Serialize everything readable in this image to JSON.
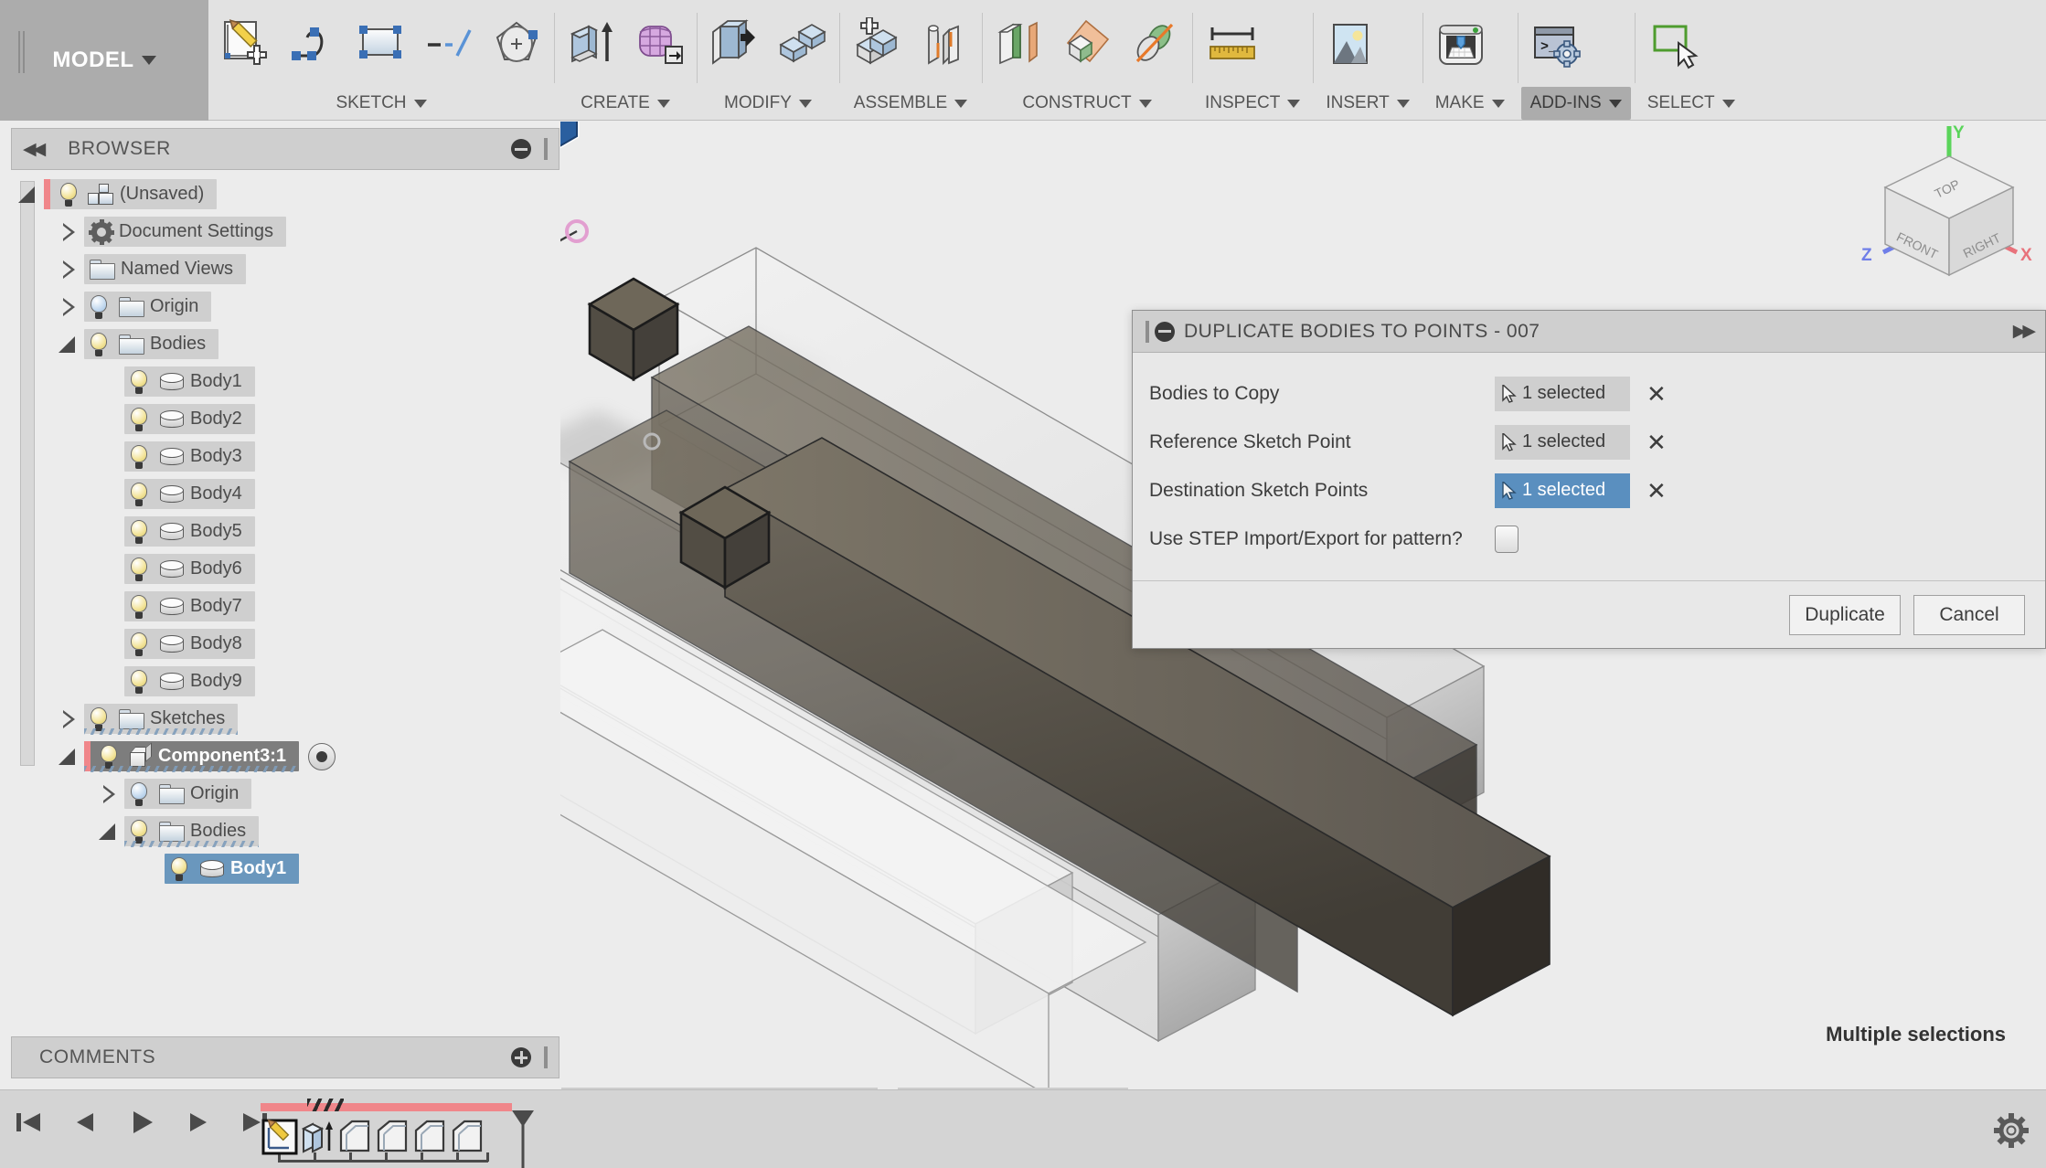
{
  "app": {
    "workspace_tab": "MODEL"
  },
  "ribbon": {
    "groups": [
      {
        "label": "SKETCH",
        "active": false,
        "icons": [
          "create-sketch-icon",
          "spline-icon",
          "rectangle-icon",
          "sketch-dimension-icon",
          "polygon-icon"
        ]
      },
      {
        "label": "CREATE",
        "active": false,
        "icons": [
          "extrude-icon",
          "mesh-create-icon"
        ]
      },
      {
        "label": "MODIFY",
        "active": false,
        "icons": [
          "press-pull-icon",
          "combine-icon"
        ]
      },
      {
        "label": "ASSEMBLE",
        "active": false,
        "icons": [
          "new-component-icon",
          "joint-icon"
        ]
      },
      {
        "label": "CONSTRUCT",
        "active": false,
        "icons": [
          "offset-plane-icon",
          "plane-at-angle-icon",
          "axis-through-cylinder-icon"
        ]
      },
      {
        "label": "INSPECT",
        "active": false,
        "icons": [
          "measure-icon"
        ]
      },
      {
        "label": "INSERT",
        "active": false,
        "icons": [
          "insert-image-icon"
        ]
      },
      {
        "label": "MAKE",
        "active": false,
        "icons": [
          "3d-print-icon"
        ]
      },
      {
        "label": "ADD-INS",
        "active": true,
        "icons": [
          "scripts-addins-icon"
        ]
      },
      {
        "label": "SELECT",
        "active": false,
        "icons": [
          "select-window-icon"
        ]
      }
    ]
  },
  "browser": {
    "title": "BROWSER",
    "collapse_icon": "double-left-arrow-icon",
    "minimize_icon": "minimize-icon",
    "tree": [
      {
        "label": "(Unsaved)",
        "indent": 0,
        "expander": "down",
        "bulb": "on",
        "icon": "assembly-icon",
        "state": "header",
        "redbar": true,
        "sketchline": false
      },
      {
        "label": "Document Settings",
        "indent": 1,
        "expander": "right",
        "bulb": "none",
        "icon": "gear-icon",
        "state": "normal",
        "redbar": false,
        "sketchline": false
      },
      {
        "label": "Named Views",
        "indent": 1,
        "expander": "right",
        "bulb": "none",
        "icon": "folder-icon",
        "state": "normal",
        "redbar": false,
        "sketchline": false
      },
      {
        "label": "Origin",
        "indent": 1,
        "expander": "right",
        "bulb": "off",
        "icon": "folder-icon",
        "state": "normal",
        "redbar": false,
        "sketchline": false
      },
      {
        "label": "Bodies",
        "indent": 1,
        "expander": "down",
        "bulb": "on",
        "icon": "folder-icon",
        "state": "normal",
        "redbar": false,
        "sketchline": false
      },
      {
        "label": "Body1",
        "indent": 2,
        "expander": "none",
        "bulb": "on",
        "icon": "body-icon",
        "state": "normal",
        "redbar": false,
        "sketchline": false
      },
      {
        "label": "Body2",
        "indent": 2,
        "expander": "none",
        "bulb": "on",
        "icon": "body-icon",
        "state": "normal",
        "redbar": false,
        "sketchline": false
      },
      {
        "label": "Body3",
        "indent": 2,
        "expander": "none",
        "bulb": "on",
        "icon": "body-icon",
        "state": "normal",
        "redbar": false,
        "sketchline": false
      },
      {
        "label": "Body4",
        "indent": 2,
        "expander": "none",
        "bulb": "on",
        "icon": "body-icon",
        "state": "normal",
        "redbar": false,
        "sketchline": false
      },
      {
        "label": "Body5",
        "indent": 2,
        "expander": "none",
        "bulb": "on",
        "icon": "body-icon",
        "state": "normal",
        "redbar": false,
        "sketchline": false
      },
      {
        "label": "Body6",
        "indent": 2,
        "expander": "none",
        "bulb": "on",
        "icon": "body-icon",
        "state": "normal",
        "redbar": false,
        "sketchline": false
      },
      {
        "label": "Body7",
        "indent": 2,
        "expander": "none",
        "bulb": "on",
        "icon": "body-icon",
        "state": "normal",
        "redbar": false,
        "sketchline": false
      },
      {
        "label": "Body8",
        "indent": 2,
        "expander": "none",
        "bulb": "on",
        "icon": "body-icon",
        "state": "normal",
        "redbar": false,
        "sketchline": false
      },
      {
        "label": "Body9",
        "indent": 2,
        "expander": "none",
        "bulb": "on",
        "icon": "body-icon",
        "state": "normal",
        "redbar": false,
        "sketchline": false
      },
      {
        "label": "Sketches",
        "indent": 1,
        "expander": "right",
        "bulb": "on",
        "icon": "folder-icon",
        "state": "normal",
        "redbar": false,
        "sketchline": true
      },
      {
        "label": "Component3:1",
        "indent": 1,
        "expander": "down",
        "bulb": "on",
        "icon": "component-icon",
        "state": "active",
        "redbar": true,
        "sketchline": true,
        "radio": true
      },
      {
        "label": "Origin",
        "indent": 2,
        "expander": "right",
        "bulb": "off",
        "icon": "folder-icon",
        "state": "normal",
        "redbar": false,
        "sketchline": false
      },
      {
        "label": "Bodies",
        "indent": 2,
        "expander": "down",
        "bulb": "on",
        "icon": "folder-icon",
        "state": "normal",
        "redbar": false,
        "sketchline": true
      },
      {
        "label": "Body1",
        "indent": 3,
        "expander": "none",
        "bulb": "on",
        "icon": "body-icon",
        "state": "selected",
        "redbar": false,
        "sketchline": false
      }
    ]
  },
  "comments": {
    "title": "COMMENTS",
    "add_icon": "plus-circle-icon"
  },
  "dialog": {
    "title": "DUPLICATE BODIES TO POINTS - 007",
    "collapse_icon": "minimize-icon",
    "expand_icon": "double-right-arrow-icon",
    "rows": [
      {
        "label": "Bodies to Copy",
        "type": "selection",
        "value": "1 selected",
        "active": false,
        "clear_icon": "x-icon"
      },
      {
        "label": "Reference Sketch Point",
        "type": "selection",
        "value": "1 selected",
        "active": false,
        "clear_icon": "x-icon"
      },
      {
        "label": "Destination Sketch Points",
        "type": "selection",
        "value": "1 selected",
        "active": true,
        "clear_icon": "x-icon"
      },
      {
        "label": "Use STEP Import/Export for pattern?",
        "type": "checkbox",
        "checked": false
      }
    ],
    "ok_label": "Duplicate",
    "cancel_label": "Cancel"
  },
  "viewport": {
    "status_text": "Multiple selections",
    "viewcube": {
      "top": "TOP",
      "front": "FRONT",
      "right": "RIGHT",
      "axis_x": "X",
      "axis_y": "Y",
      "axis_z": "Z",
      "color_x": "#e8727b",
      "color_y": "#5ad45a",
      "color_z": "#6f7ee8"
    },
    "highlighted_body_color": "#2f6cb5"
  },
  "navbar": {
    "groups": [
      {
        "buttons": [
          {
            "icon": "orbit-icon",
            "caret": true
          },
          {
            "icon": "look-at-icon",
            "caret": false
          },
          {
            "icon": "pan-icon",
            "caret": false
          },
          {
            "icon": "zoom-in-icon",
            "caret": false
          },
          {
            "icon": "fit-icon",
            "caret": true
          }
        ]
      },
      {
        "buttons": [
          {
            "icon": "display-settings-icon",
            "caret": true
          },
          {
            "icon": "grid-snap-icon",
            "caret": true
          },
          {
            "icon": "viewports-icon",
            "caret": true
          }
        ]
      }
    ]
  },
  "timeline": {
    "playback": [
      {
        "icon": "go-to-beginning-icon"
      },
      {
        "icon": "step-back-icon"
      },
      {
        "icon": "play-icon"
      },
      {
        "icon": "step-forward-icon"
      },
      {
        "icon": "go-to-end-icon"
      }
    ],
    "features": [
      {
        "icon": "sketch-feature-icon",
        "selected": true
      },
      {
        "icon": "extrude-feature-icon",
        "selected": false
      },
      {
        "icon": "body-feature-icon",
        "selected": false
      },
      {
        "icon": "body-feature-icon",
        "selected": false
      },
      {
        "icon": "body-feature-icon",
        "selected": false
      },
      {
        "icon": "body-feature-icon",
        "selected": false
      }
    ],
    "marker_icon": "timeline-marker-icon",
    "settings_icon": "gear-icon",
    "progress_color": "#f0868a"
  }
}
